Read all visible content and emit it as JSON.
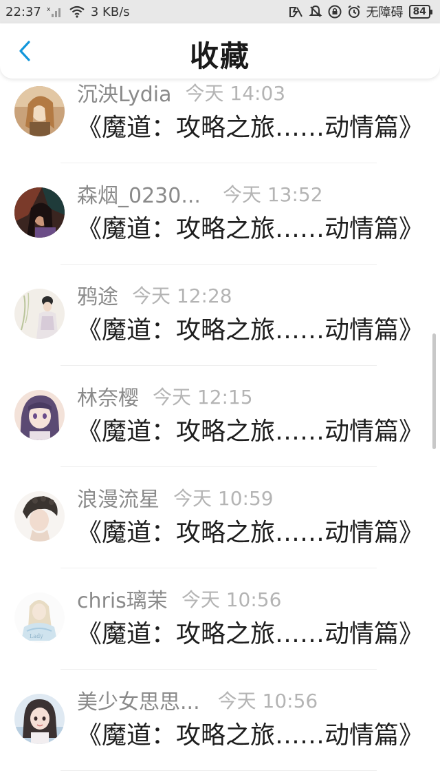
{
  "status_bar": {
    "time": "22:37",
    "network_speed": "3 KB/s",
    "sim_status": "无障碍",
    "battery": "84"
  },
  "header": {
    "title": "收藏",
    "back_icon": "chevron-left-icon",
    "accent_color": "#1296db"
  },
  "list": [
    {
      "user": "沉泱Lydia",
      "time": "今天 14:03",
      "title": "《魔道：攻略之旅……动情篇》"
    },
    {
      "user": "森烟_0230...",
      "time": "今天 13:52",
      "title": "《魔道：攻略之旅……动情篇》"
    },
    {
      "user": "鸦途",
      "time": "今天 12:28",
      "title": "《魔道：攻略之旅……动情篇》"
    },
    {
      "user": "林奈樱",
      "time": "今天 12:15",
      "title": "《魔道：攻略之旅……动情篇》"
    },
    {
      "user": "浪漫流星",
      "time": "今天 10:59",
      "title": "《魔道：攻略之旅……动情篇》"
    },
    {
      "user": "chris璃茉",
      "time": "今天 10:56",
      "title": "《魔道：攻略之旅……动情篇》"
    },
    {
      "user": "美少女思思...",
      "time": "今天 10:56",
      "title": "《魔道：攻略之旅……动情篇》"
    }
  ]
}
